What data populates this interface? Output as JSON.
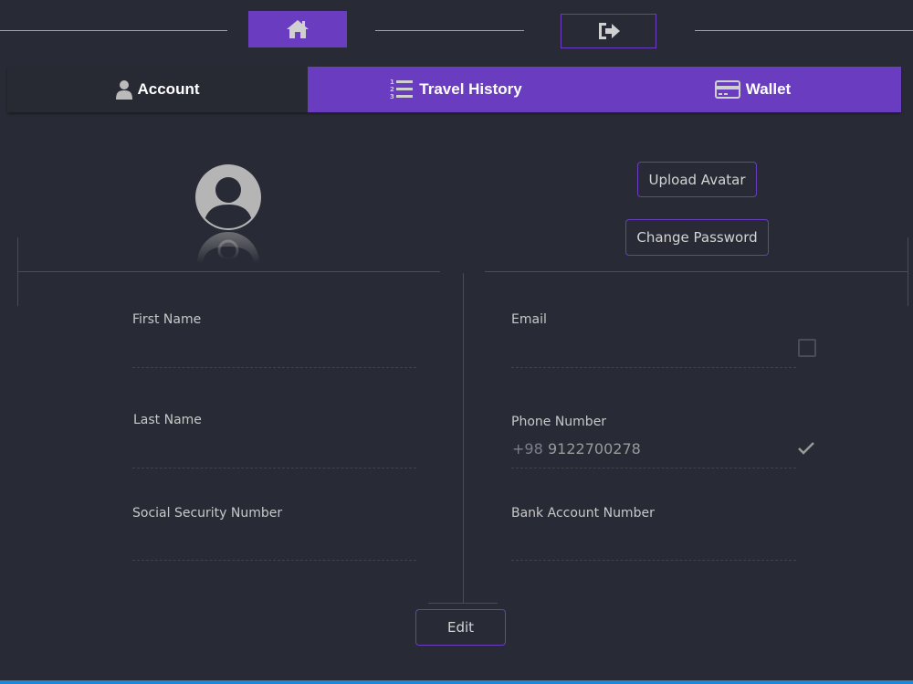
{
  "header": {
    "home_icon": "home-icon",
    "logout_icon": "sign-out-icon",
    "accent_color": "#6a3dc0",
    "line_color": "#c9a042"
  },
  "tabs": [
    {
      "label": "Account",
      "icon": "user-icon",
      "active": true
    },
    {
      "label": "Travel History",
      "icon": "numbered-list-icon",
      "active": false
    },
    {
      "label": "Wallet",
      "icon": "credit-card-icon",
      "active": false
    }
  ],
  "profile": {
    "avatar_icon": "user-avatar-icon",
    "upload_avatar_label": "Upload Avatar",
    "change_password_label": "Change Password"
  },
  "form": {
    "first_name": {
      "label": "First Name",
      "value": ""
    },
    "last_name": {
      "label": "Last Name",
      "value": ""
    },
    "ssn": {
      "label": "Social Security Number",
      "value": ""
    },
    "email": {
      "label": "Email",
      "value": "",
      "verified": false
    },
    "phone": {
      "label": "Phone Number",
      "prefix": "+98",
      "value": "9122700278",
      "verified": true
    },
    "bank_account": {
      "label": "Bank Account Number",
      "value": ""
    }
  },
  "actions": {
    "edit_label": "Edit"
  }
}
